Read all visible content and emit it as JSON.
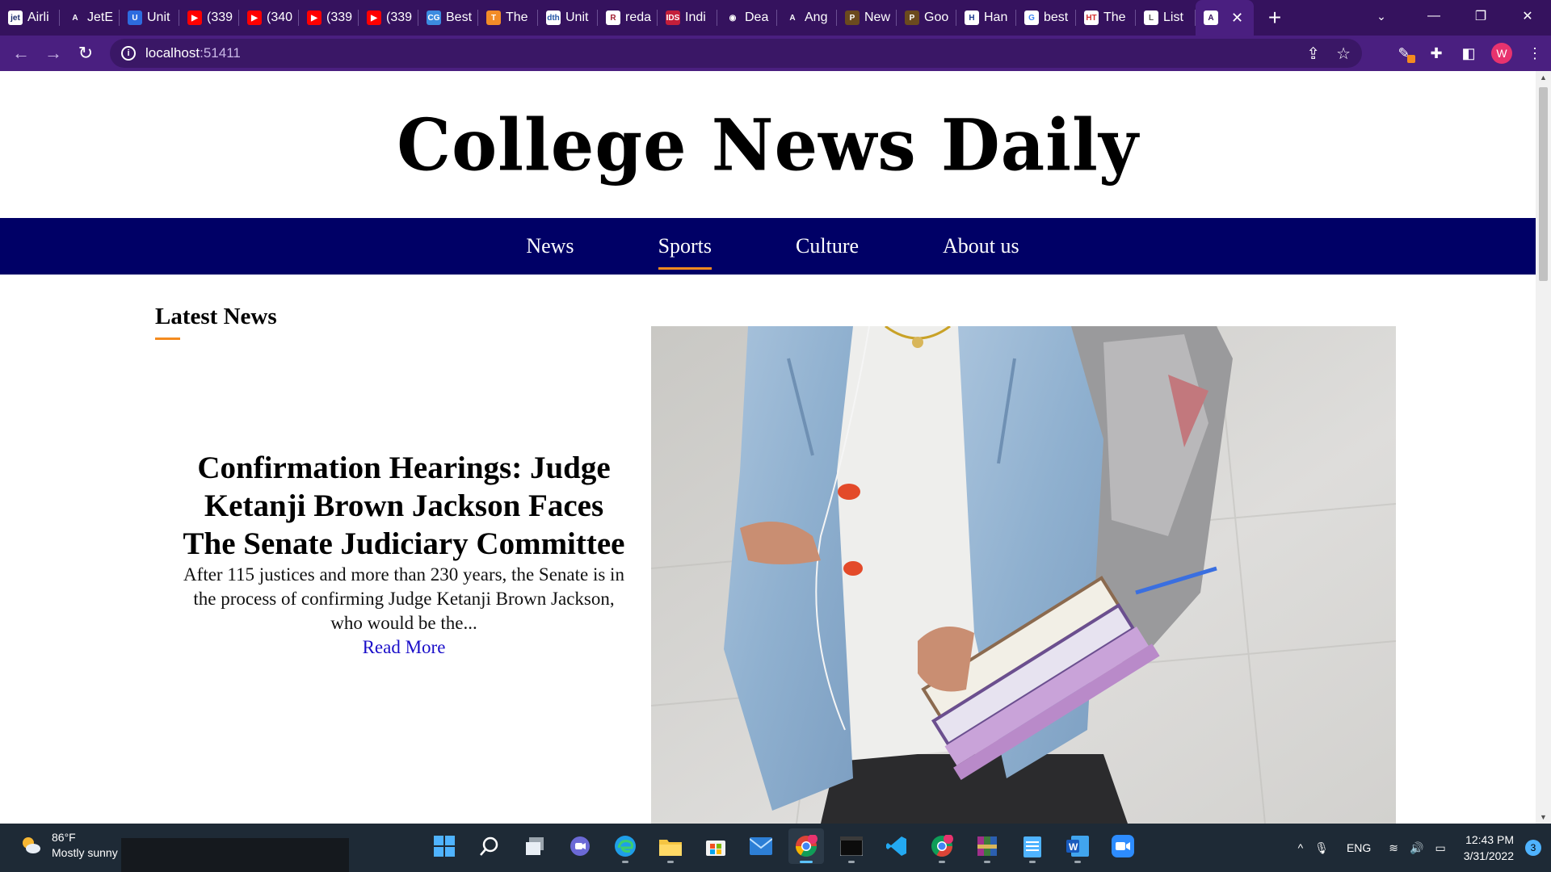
{
  "browser": {
    "tabs": [
      {
        "fav": "jet",
        "fav_bg": "#ffffff",
        "fav_fg": "#1a2b6b",
        "title": "Airli"
      },
      {
        "fav": "A",
        "fav_bg": "#35125e",
        "fav_fg": "#ffffff",
        "title": "JetE"
      },
      {
        "fav": "U",
        "fav_bg": "#2d6cdf",
        "fav_fg": "#ffffff",
        "title": "Unit"
      },
      {
        "fav": "▶",
        "fav_bg": "#ff0000",
        "fav_fg": "#ffffff",
        "title": "(339"
      },
      {
        "fav": "▶",
        "fav_bg": "#ff0000",
        "fav_fg": "#ffffff",
        "title": "(340"
      },
      {
        "fav": "▶",
        "fav_bg": "#ff0000",
        "fav_fg": "#ffffff",
        "title": "(339"
      },
      {
        "fav": "▶",
        "fav_bg": "#ff0000",
        "fav_fg": "#ffffff",
        "title": "(339"
      },
      {
        "fav": "CG",
        "fav_bg": "#3c8be0",
        "fav_fg": "#ffffff",
        "title": "Best"
      },
      {
        "fav": "T",
        "fav_bg": "#f28c28",
        "fav_fg": "#ffffff",
        "title": "The"
      },
      {
        "fav": "dth",
        "fav_bg": "#ffffff",
        "fav_fg": "#2456a6",
        "title": "Unit"
      },
      {
        "fav": "R",
        "fav_bg": "#ffffff",
        "fav_fg": "#a12233",
        "title": "reda"
      },
      {
        "fav": "IDS",
        "fav_bg": "#c41e3a",
        "fav_fg": "#ffffff",
        "title": "Indi"
      },
      {
        "fav": "◉",
        "fav_bg": "#35125e",
        "fav_fg": "#ffffff",
        "title": "Dea"
      },
      {
        "fav": "A",
        "fav_bg": "#35125e",
        "fav_fg": "#ffffff",
        "title": "Ang"
      },
      {
        "fav": "P",
        "fav_bg": "#6b4a1e",
        "fav_fg": "#ffffff",
        "title": "New"
      },
      {
        "fav": "P",
        "fav_bg": "#6b4a1e",
        "fav_fg": "#ffffff",
        "title": "Goo"
      },
      {
        "fav": "H",
        "fav_bg": "#ffffff",
        "fav_fg": "#1f3b8f",
        "title": "Han"
      },
      {
        "fav": "G",
        "fav_bg": "#ffffff",
        "fav_fg": "#4285f4",
        "title": "best"
      },
      {
        "fav": "HT",
        "fav_bg": "#ffffff",
        "fav_fg": "#d32f2f",
        "title": "The"
      },
      {
        "fav": "L",
        "fav_bg": "#ffffff",
        "fav_fg": "#555555",
        "title": "List"
      }
    ],
    "active_tab": {
      "fav": "A",
      "title": ""
    },
    "url_host": "localhost",
    "url_port": ":51411",
    "profile_initial": "W"
  },
  "site": {
    "title": "College News Daily",
    "nav": [
      {
        "label": "News",
        "active": false
      },
      {
        "label": "Sports",
        "active": true
      },
      {
        "label": "Culture",
        "active": false
      },
      {
        "label": "About us",
        "active": false
      }
    ],
    "section_title": "Latest News",
    "article": {
      "headline": "Confirmation Hearings: Judge Ketanji Brown Jackson Faces The Senate Judiciary Committee",
      "excerpt": "After 115 justices and more than 230 years, the Senate is in the process of confirming Judge Ketanji Brown Jackson, who would be the...",
      "read_more": "Read More"
    }
  },
  "taskbar": {
    "weather_temp": "86°F",
    "weather_desc": "Mostly sunny",
    "language": "ENG",
    "time": "12:43 PM",
    "date": "3/31/2022",
    "notifications": "3"
  },
  "colors": {
    "tab_bg": "#35125e",
    "toolbar_bg": "#4a1f80",
    "nav_bg": "#000066",
    "accent": "#f48b1f",
    "link": "#1a0ec9"
  }
}
